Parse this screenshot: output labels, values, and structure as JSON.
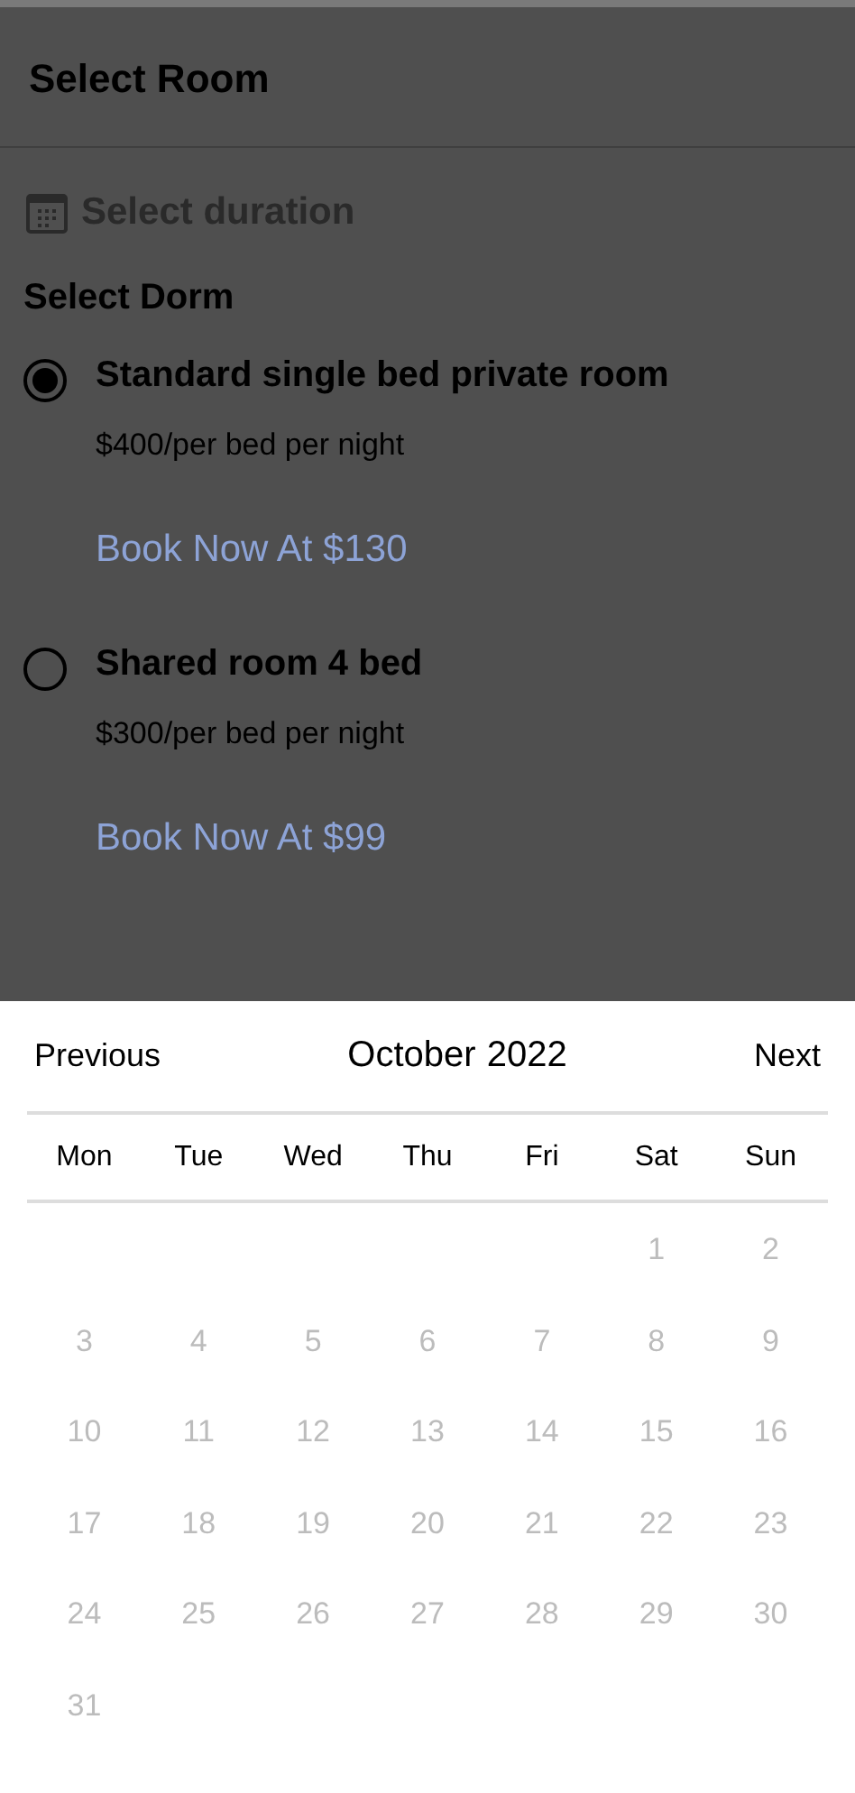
{
  "header": {
    "title": "Select Room"
  },
  "duration": {
    "label": "Select duration"
  },
  "dorm": {
    "heading": "Select Dorm",
    "rooms": [
      {
        "name": "Standard single bed private room",
        "price": "$400/per bed per night",
        "book": "Book Now At $130",
        "selected": true
      },
      {
        "name": "Shared room 4 bed",
        "price": "$300/per bed per night",
        "book": "Book Now At $99",
        "selected": false
      }
    ]
  },
  "calendar": {
    "previous": "Previous",
    "month": "October",
    "year": "2022",
    "next": "Next",
    "weekdays": [
      "Mon",
      "Tue",
      "Wed",
      "Thu",
      "Fri",
      "Sat",
      "Sun"
    ],
    "weeks": [
      {
        "kind": "first",
        "days": [
          {
            "day": "1",
            "disabled": true
          },
          {
            "day": "2",
            "disabled": true
          }
        ]
      },
      {
        "kind": "full",
        "days": [
          {
            "day": "3",
            "disabled": true
          },
          {
            "day": "4",
            "disabled": true
          },
          {
            "day": "5",
            "disabled": true
          },
          {
            "day": "6",
            "disabled": true
          },
          {
            "day": "7",
            "disabled": true
          },
          {
            "day": "8",
            "disabled": true
          },
          {
            "day": "9",
            "disabled": true
          }
        ]
      },
      {
        "kind": "full",
        "days": [
          {
            "day": "10",
            "disabled": true
          },
          {
            "day": "11",
            "disabled": true
          },
          {
            "day": "12",
            "disabled": true
          },
          {
            "day": "13",
            "disabled": true
          },
          {
            "day": "14",
            "disabled": true
          },
          {
            "day": "15",
            "disabled": true
          },
          {
            "day": "16",
            "disabled": true
          }
        ]
      },
      {
        "kind": "full",
        "days": [
          {
            "day": "17",
            "disabled": true
          },
          {
            "day": "18",
            "disabled": true
          },
          {
            "day": "19",
            "disabled": true
          },
          {
            "day": "20",
            "disabled": true
          },
          {
            "day": "21",
            "disabled": true
          },
          {
            "day": "22",
            "disabled": true
          },
          {
            "day": "23",
            "disabled": true
          }
        ]
      },
      {
        "kind": "full",
        "days": [
          {
            "day": "24",
            "disabled": true
          },
          {
            "day": "25",
            "disabled": true
          },
          {
            "day": "26",
            "disabled": true
          },
          {
            "day": "27",
            "disabled": true
          },
          {
            "day": "28",
            "disabled": true
          },
          {
            "day": "29",
            "disabled": true
          },
          {
            "day": "30",
            "disabled": true
          }
        ]
      },
      {
        "kind": "last",
        "days": [
          {
            "day": "31",
            "disabled": true
          }
        ]
      }
    ]
  }
}
